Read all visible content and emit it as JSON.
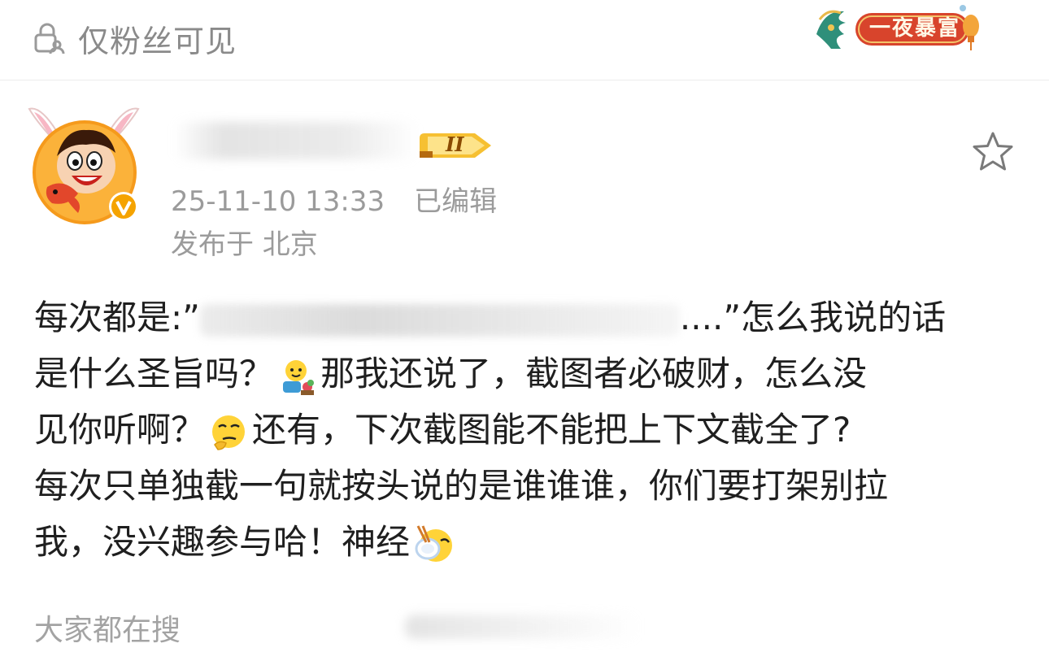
{
  "header": {
    "visibility_label": "仅粉丝可见",
    "lock_icon": "lock-person-icon",
    "decor_badge_label": "一夜暴富"
  },
  "post": {
    "level_badge": "II",
    "timestamp": "25-11-10 13:33",
    "edited_label": "已编辑",
    "location": "发布于 北京",
    "favorite_icon": "star-outline-icon",
    "body": {
      "line1_prefix": "每次都是:”",
      "line1_suffix": "....”怎么我说的话",
      "line2_a": "是什么圣旨吗？",
      "line2_b": "那我还说了，截图者必破财，怎么没",
      "line3_a": "见你听啊？",
      "line3_b": "还有，下次截图能不能把上下文截全了?",
      "line4": "每次只单独截一句就按头说的是谁谁谁，你们要打架别拉",
      "line5": "我，没兴趣参与哈！神经"
    }
  },
  "footer": {
    "trending_label": "大家都在搜"
  },
  "colors": {
    "meta_gray": "#9b9b9b",
    "badge_red": "#d8442c",
    "badge_gold": "#f3b23a",
    "verified_orange": "#f5a300"
  }
}
